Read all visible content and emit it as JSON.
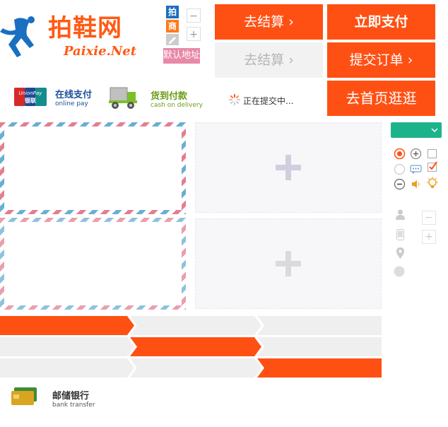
{
  "logo": {
    "name": "拍鞋网",
    "sub": "Paixie.Net"
  },
  "tags": [
    "拍",
    "商"
  ],
  "stepper": {
    "minus": "−",
    "plus": "+"
  },
  "default_address": "默认地址",
  "buttons": {
    "checkout_active": "去结算 ›",
    "pay_now": "立即支付",
    "checkout_disabled": "去结算 ›",
    "submit_order": "提交订单 ›",
    "go_home": "去首页逛逛"
  },
  "payments": [
    {
      "title": "在线支付",
      "sub": "online pay",
      "logo": "UnionPay 银联"
    },
    {
      "title": "货到付款",
      "sub": "cash on delivery"
    }
  ],
  "submitting": "正在提交中...",
  "bank": {
    "title": "邮储银行",
    "sub": "bank transfer"
  },
  "colors": {
    "accent": "#ff5014",
    "green": "#1db38a",
    "grey": "#efefef"
  },
  "progress_steps": [
    {
      "active_index": 0
    },
    {
      "active_index": 1
    },
    {
      "active_index": 2
    }
  ]
}
